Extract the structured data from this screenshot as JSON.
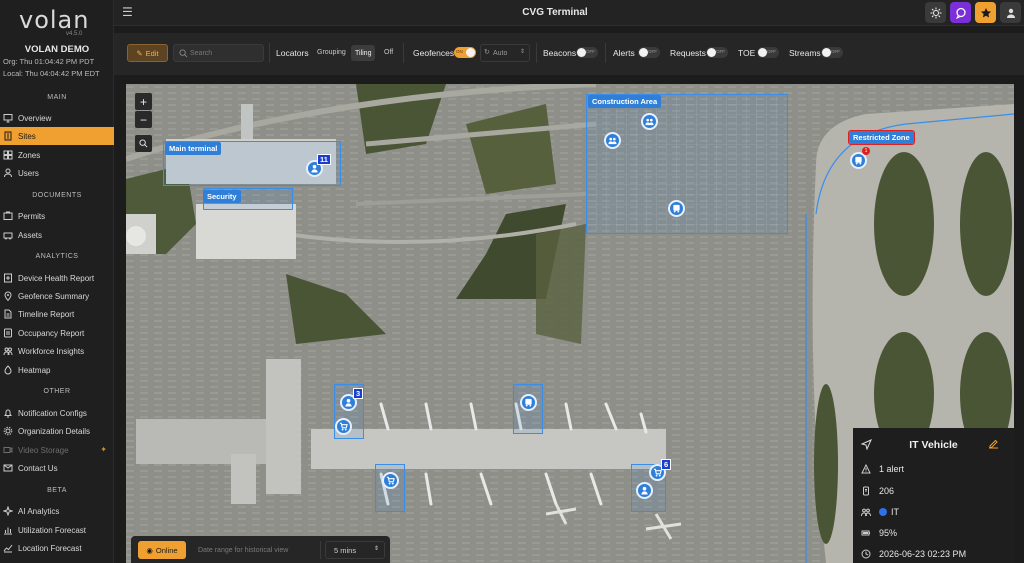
{
  "brand": {
    "logo": "volan",
    "version": "v4.5.0"
  },
  "org": {
    "name": "VOLAN DEMO",
    "org_time": "Org: Thu 01:04:42 PM PDT",
    "local_time": "Local: Thu 04:04:42 PM EDT"
  },
  "sidebar": {
    "sections": [
      {
        "title": "MAIN",
        "items": [
          {
            "label": "Overview",
            "icon": "monitor-icon"
          },
          {
            "label": "Sites",
            "icon": "building-icon",
            "active": true
          },
          {
            "label": "Zones",
            "icon": "zones-icon"
          },
          {
            "label": "Users",
            "icon": "users-icon"
          }
        ]
      },
      {
        "title": "DOCUMENTS",
        "items": [
          {
            "label": "Permits",
            "icon": "permit-icon"
          },
          {
            "label": "Assets",
            "icon": "asset-icon"
          }
        ]
      },
      {
        "title": "ANALYTICS",
        "items": [
          {
            "label": "Device Health Report",
            "icon": "health-icon"
          },
          {
            "label": "Geofence Summary",
            "icon": "pin-icon"
          },
          {
            "label": "Timeline Report",
            "icon": "doc-icon"
          },
          {
            "label": "Occupancy Report",
            "icon": "occupancy-icon"
          },
          {
            "label": "Workforce Insights",
            "icon": "insights-icon"
          },
          {
            "label": "Heatmap",
            "icon": "heatmap-icon"
          }
        ]
      },
      {
        "title": "OTHER",
        "items": [
          {
            "label": "Notification Configs",
            "icon": "bell-icon"
          },
          {
            "label": "Organization Details",
            "icon": "gear-icon"
          },
          {
            "label": "Video Storage",
            "icon": "video-icon",
            "disabled": true
          },
          {
            "label": "Contact Us",
            "icon": "mail-icon"
          }
        ]
      },
      {
        "title": "BETA",
        "items": [
          {
            "label": "AI Analytics",
            "icon": "ai-icon"
          },
          {
            "label": "Utilization Forecast",
            "icon": "chart-icon"
          },
          {
            "label": "Location Forecast",
            "icon": "forecast-icon"
          }
        ]
      }
    ]
  },
  "topbar": {
    "title": "CVG Terminal"
  },
  "toolbar": {
    "edit_label": "Edit",
    "search_placeholder": "Search",
    "locators_label": "Locators",
    "locator_modes": [
      "Grouping",
      "Tiling",
      "Off"
    ],
    "locator_selected": "Tiling",
    "geofences_label": "Geofences",
    "geofences_toggle": "on",
    "auto_label": "Auto",
    "beacons_label": "Beacons",
    "alerts_label": "Alerts",
    "requests_label": "Requests",
    "toe_label": "TOE",
    "streams_label": "Streams",
    "off_text": "OFF"
  },
  "map": {
    "zones": [
      {
        "name": "Main terminal"
      },
      {
        "name": "Security"
      },
      {
        "name": "Construction Area"
      },
      {
        "name": "Restricted Zone"
      }
    ],
    "counts": {
      "main": "11",
      "gate_a": "3",
      "gate_b": "6"
    },
    "alert_count": "1"
  },
  "bottombar": {
    "online_label": "Online",
    "date_placeholder": "Date range for historical view",
    "interval": "5 mins"
  },
  "info_panel": {
    "title": "IT Vehicle",
    "alerts": "1 alert",
    "id": "206",
    "group": "IT",
    "group_color": "#2f6fe8",
    "battery": "95%",
    "timestamp": "2026-06-23 02:23 PM"
  }
}
